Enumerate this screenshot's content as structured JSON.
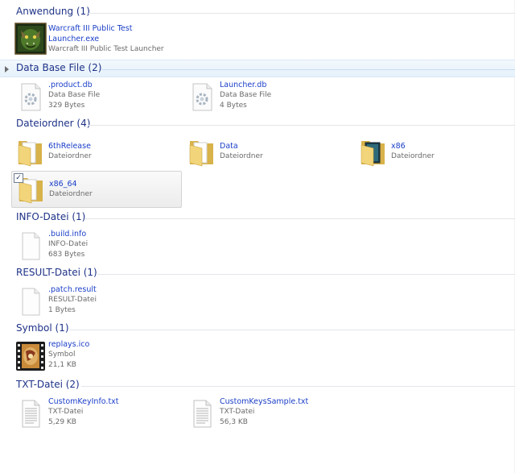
{
  "groups": [
    {
      "title": "Anwendung (1)",
      "items": [
        {
          "icon": "warcraft-orc-icon",
          "name": "Warcraft III Public Test Launcher.exe",
          "line1": "Warcraft III Public Test Launcher"
        }
      ]
    },
    {
      "title": "Data Base File (2)",
      "items": [
        {
          "icon": "gear-file-icon",
          "name": ".product.db",
          "line1": "Data Base File",
          "line2": "329 Bytes"
        },
        {
          "icon": "gear-file-icon",
          "name": "Launcher.db",
          "line1": "Data Base File",
          "line2": "4 Bytes"
        }
      ]
    },
    {
      "title": "Dateiordner (4)",
      "items": [
        {
          "icon": "folder-icon",
          "name": "6thRelease",
          "line1": "Dateiordner"
        },
        {
          "icon": "folder-icon",
          "name": "Data",
          "line1": "Dateiordner"
        },
        {
          "icon": "folder-icon",
          "name": "x86",
          "line1": "Dateiordner"
        },
        {
          "icon": "folder-icon",
          "name": "x86_64",
          "line1": "Dateiordner",
          "checked": true
        }
      ]
    },
    {
      "title": "INFO-Datei (1)",
      "items": [
        {
          "icon": "blank-file-icon",
          "name": ".build.info",
          "line1": "INFO-Datei",
          "line2": "683 Bytes"
        }
      ]
    },
    {
      "title": "RESULT-Datei (1)",
      "items": [
        {
          "icon": "blank-file-icon",
          "name": ".patch.result",
          "line1": "RESULT-Datei",
          "line2": "1 Bytes"
        }
      ]
    },
    {
      "title": "Symbol (1)",
      "items": [
        {
          "icon": "replays-icon",
          "name": "replays.ico",
          "line1": "Symbol",
          "line2": "21,1 KB"
        }
      ]
    },
    {
      "title": "TXT-Datei (2)",
      "items": [
        {
          "icon": "text-file-icon",
          "name": "CustomKeyInfo.txt",
          "line1": "TXT-Datei",
          "line2": "5,29 KB"
        },
        {
          "icon": "text-file-icon",
          "name": "CustomKeysSample.txt",
          "line1": "TXT-Datei",
          "line2": "56,3 KB"
        }
      ]
    }
  ]
}
